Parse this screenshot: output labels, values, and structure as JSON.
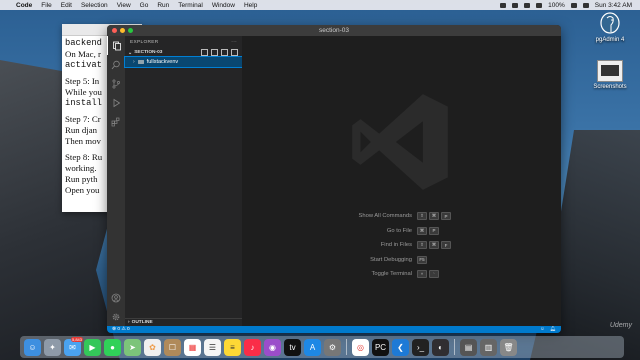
{
  "menubar": {
    "app_name": "Code",
    "items": [
      "File",
      "Edit",
      "Selection",
      "View",
      "Go",
      "Run",
      "Terminal",
      "Window",
      "Help"
    ],
    "battery": "100%",
    "clock": "Sun 3:42 AM"
  },
  "document": {
    "lines": [
      {
        "text": "backend",
        "mono": true
      },
      {
        "text": "On Mac, r",
        "mono": false
      },
      {
        "text": "activat",
        "mono": true
      },
      {
        "gap": true
      },
      {
        "text": "Step 5: In",
        "mono": false
      },
      {
        "text": "While you",
        "mono": false
      },
      {
        "text": "install",
        "mono": true
      },
      {
        "gap": true
      },
      {
        "text": "Step 7: Cr",
        "mono": false
      },
      {
        "text": "Run djan",
        "mono": false
      },
      {
        "text": "Then mov",
        "mono": false
      },
      {
        "gap": true
      },
      {
        "text": "Step 8: Ru",
        "mono": false
      },
      {
        "text": "working.",
        "mono": false
      },
      {
        "text": "Run pyth",
        "mono": false
      },
      {
        "text": "Open you",
        "mono": false
      }
    ]
  },
  "desktop_icons": {
    "pgadmin": "pgAdmin 4",
    "screenshots": "Screenshots"
  },
  "vscode": {
    "window_title": "section-03",
    "explorer_title": "EXPLORER",
    "section_title": "SECTION-03",
    "tree_item": "fullstackvenv",
    "outline_title": "OUTLINE",
    "shortcuts": [
      {
        "label": "Show All Commands",
        "keys": [
          "⇧",
          "⌘",
          "P"
        ]
      },
      {
        "label": "Go to File",
        "keys": [
          "⌘",
          "P"
        ]
      },
      {
        "label": "Find in Files",
        "keys": [
          "⇧",
          "⌘",
          "F"
        ]
      },
      {
        "label": "Start Debugging",
        "keys": [
          "F5"
        ]
      },
      {
        "label": "Toggle Terminal",
        "keys": [
          "^",
          "`"
        ]
      }
    ],
    "status": {
      "problems": "⊗ 0 ⚠ 0"
    }
  },
  "dock": {
    "mail_badge": "5,843",
    "apps": [
      "finder",
      "launchpad",
      "mail",
      "facetime",
      "messages",
      "maps",
      "photos",
      "contacts",
      "calendar",
      "reminders",
      "notes",
      "music",
      "podcasts",
      "tv",
      "appstore",
      "preferences",
      "chrome",
      "pycharm",
      "vscode",
      "terminal",
      "obs"
    ]
  },
  "watermark": "Udemy",
  "colors": {
    "vscode_blue": "#007acc",
    "activity_bar": "#333333",
    "sidebar": "#252526",
    "editor_bg": "#1e1e1e"
  }
}
